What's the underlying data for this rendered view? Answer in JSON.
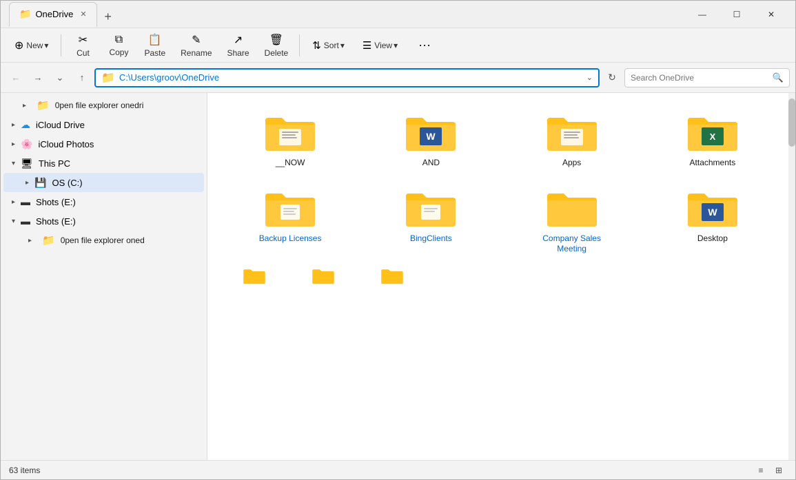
{
  "window": {
    "title": "OneDrive",
    "controls": {
      "minimize": "—",
      "maximize": "☐",
      "close": "✕"
    }
  },
  "tabs": [
    {
      "label": "OneDrive",
      "active": true
    },
    {
      "label": "+",
      "is_new": true
    }
  ],
  "toolbar": {
    "new_label": "New",
    "cut_label": "Cut",
    "copy_label": "Copy",
    "paste_label": "Paste",
    "rename_label": "Rename",
    "share_label": "Share",
    "delete_label": "Delete",
    "sort_label": "Sort",
    "view_label": "View",
    "more_label": "···"
  },
  "addressbar": {
    "path": "C:\\Users\\groov\\OneDrive",
    "placeholder": "Search OneDrive"
  },
  "sidebar": {
    "items": [
      {
        "label": "0pen file explorer onedri",
        "icon": "📁",
        "type": "folder",
        "indent": 0
      },
      {
        "label": "iCloud Drive",
        "icon": "☁",
        "icon_color": "#1a8fe3",
        "type": "item",
        "indent": 0
      },
      {
        "label": "iCloud Photos",
        "icon": "🔴",
        "type": "item",
        "indent": 0
      },
      {
        "label": "This PC",
        "icon": "🖥",
        "type": "item",
        "indent": 0,
        "expanded": true
      },
      {
        "label": "OS (C:)",
        "icon": "💾",
        "type": "item",
        "indent": 1,
        "active": true
      },
      {
        "label": "Shots (E:)",
        "icon": "▬",
        "type": "item",
        "indent": 0
      },
      {
        "label": "Shots (E:)",
        "icon": "▬",
        "type": "item",
        "indent": 0,
        "expanded": true
      },
      {
        "label": "0pen file explorer oned",
        "icon": "📁",
        "type": "folder",
        "indent": 1
      }
    ]
  },
  "folders": [
    {
      "name": "__NOW",
      "type": "generic",
      "embed_icon": "document"
    },
    {
      "name": "AND",
      "type": "word",
      "embed_icon": "word"
    },
    {
      "name": "Apps",
      "type": "generic",
      "embed_icon": "document"
    },
    {
      "name": "Attachments",
      "type": "excel",
      "embed_icon": "excel"
    },
    {
      "name": "Backup Licenses",
      "type": "generic",
      "embed_icon": "document",
      "label_color": "blue"
    },
    {
      "name": "BingClients",
      "type": "generic",
      "embed_icon": "document",
      "label_color": "blue"
    },
    {
      "name": "Company Sales Meeting",
      "type": "generic",
      "embed_icon": "none",
      "label_color": "blue"
    },
    {
      "name": "Desktop",
      "type": "word",
      "embed_icon": "word"
    }
  ],
  "partial_folders": [
    3
  ],
  "statusbar": {
    "items_count": "63 items",
    "view_list_icon": "≡",
    "view_grid_icon": "⊞"
  }
}
